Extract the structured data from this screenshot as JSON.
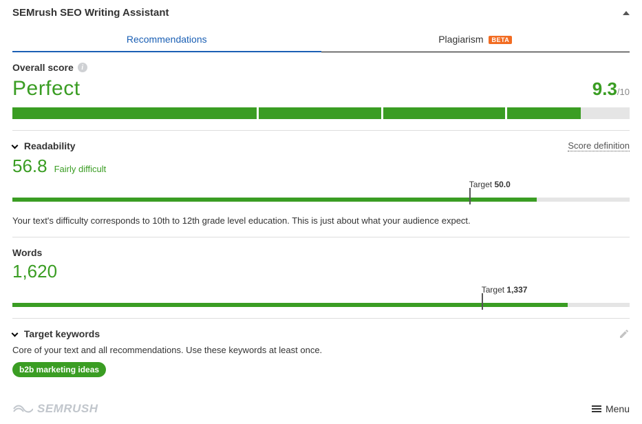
{
  "header": {
    "title": "SEMrush SEO Writing Assistant"
  },
  "tabs": {
    "recommendations": "Recommendations",
    "plagiarism": "Plagiarism",
    "plagiarism_badge": "BETA"
  },
  "overall": {
    "label": "Overall score",
    "word": "Perfect",
    "score": "9.3",
    "max": "/10"
  },
  "readability": {
    "label": "Readability",
    "score_definition": "Score definition",
    "score": "56.8",
    "level": "Fairly difficult",
    "target_prefix": "Target ",
    "target_value": "50.0",
    "explain": "Your text's difficulty corresponds to 10th to 12th grade level education. This is just about what your audience expect.",
    "fill_pct": 85,
    "target_pct": 74
  },
  "words": {
    "label": "Words",
    "count": "1,620",
    "target_prefix": "Target ",
    "target_value": "1,337",
    "fill_pct": 90,
    "target_pct": 76
  },
  "keywords": {
    "label": "Target keywords",
    "desc": "Core of your text and all recommendations. Use these keywords at least once.",
    "pill": "b2b marketing ideas"
  },
  "footer": {
    "brand": "SEMRUSH",
    "menu": "Menu"
  }
}
